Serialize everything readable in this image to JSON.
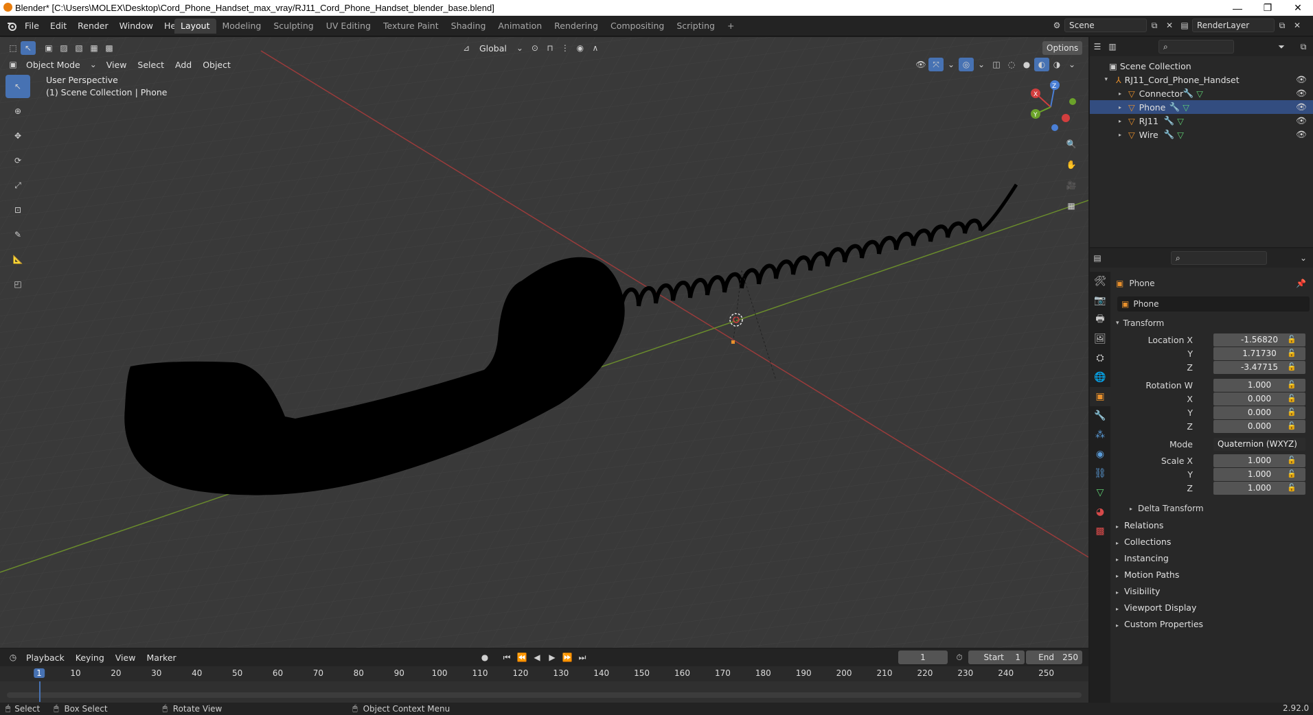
{
  "window": {
    "title": "Blender* [C:\\Users\\MOLEX\\Desktop\\Cord_Phone_Handset_max_vray/RJ11_Cord_Phone_Handset_blender_base.blend]",
    "minimize": "—",
    "maximize": "❐",
    "close": "✕"
  },
  "menu": [
    "File",
    "Edit",
    "Render",
    "Window",
    "Help"
  ],
  "workspaces": [
    "Layout",
    "Modeling",
    "Sculpting",
    "UV Editing",
    "Texture Paint",
    "Shading",
    "Animation",
    "Rendering",
    "Compositing",
    "Scripting",
    "+"
  ],
  "scene": {
    "name": "Scene",
    "render_layer": "RenderLayer"
  },
  "viewport": {
    "mode": "Object Mode",
    "menus": [
      "View",
      "Select",
      "Add",
      "Object"
    ],
    "orientation": "Global",
    "options": "Options",
    "perspective": "User Perspective",
    "collection": "(1) Scene Collection | Phone"
  },
  "gizmo": {
    "x": "X",
    "y": "Y",
    "z": "Z"
  },
  "outliner": {
    "root": "Scene Collection",
    "collection": "RJ11_Cord_Phone_Handset",
    "objects": [
      "Connector",
      "Phone",
      "RJ11",
      "Wire"
    ]
  },
  "properties": {
    "object_name": "Phone",
    "data_name": "Phone",
    "transform_label": "Transform",
    "location": {
      "label": "Location X",
      "x": "-1.56820",
      "y": "1.71730",
      "z": "-3.47715"
    },
    "rotation": {
      "label": "Rotation W",
      "w": "1.000",
      "x": "0.000",
      "y": "0.000",
      "z": "0.000"
    },
    "mode_label": "Mode",
    "mode_value": "Quaternion (WXYZ)",
    "scale": {
      "label": "Scale X",
      "x": "1.000",
      "y": "1.000",
      "z": "1.000"
    },
    "axis_y": "Y",
    "axis_z": "Z",
    "axis_x": "X",
    "delta": "Delta Transform",
    "sections": [
      "Relations",
      "Collections",
      "Instancing",
      "Motion Paths",
      "Visibility",
      "Viewport Display",
      "Custom Properties"
    ]
  },
  "timeline": {
    "menus": [
      "Playback",
      "Keying",
      "View",
      "Marker"
    ],
    "current_frame": "1",
    "start_label": "Start",
    "start": "1",
    "end_label": "End",
    "end": "250",
    "ruler": [
      "1",
      "10",
      "20",
      "30",
      "40",
      "50",
      "60",
      "70",
      "80",
      "90",
      "100",
      "110",
      "120",
      "130",
      "140",
      "150",
      "160",
      "170",
      "180",
      "190",
      "200",
      "210",
      "220",
      "230",
      "240",
      "250"
    ]
  },
  "status": {
    "select": "Select",
    "box_select": "Box Select",
    "rotate": "Rotate View",
    "context": "Object Context Menu",
    "version": "2.92.0"
  }
}
